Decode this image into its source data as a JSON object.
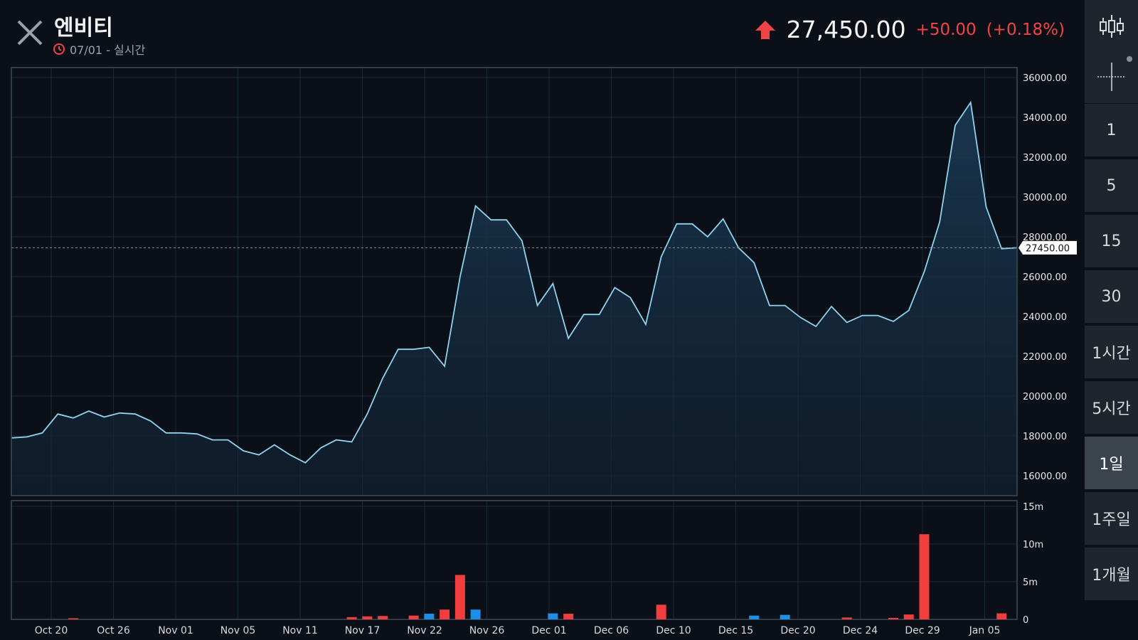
{
  "header": {
    "stock_name": "엔비티",
    "date_text": "07/01 - 실시간",
    "price": "27,450.00",
    "change": "+50.00",
    "change_pct": "(+0.18%)",
    "up_color": "#f24444"
  },
  "sidebar": {
    "items": [
      {
        "label": "",
        "icon": "candlestick-icon"
      },
      {
        "label": "",
        "icon": "crosshair-icon"
      },
      {
        "label": "1"
      },
      {
        "label": "5"
      },
      {
        "label": "15"
      },
      {
        "label": "30"
      },
      {
        "label": "1시간"
      },
      {
        "label": "5시간"
      },
      {
        "label": "1일",
        "active": true
      },
      {
        "label": "1주일"
      },
      {
        "label": "1개월"
      }
    ]
  },
  "chart_data": {
    "type": "area",
    "y_ticks": [
      "36000.00",
      "34000.00",
      "32000.00",
      "30000.00",
      "28000.00",
      "26000.00",
      "24000.00",
      "22000.00",
      "20000.00",
      "18000.00",
      "16000.00"
    ],
    "ylim": [
      15000,
      36500
    ],
    "x_ticks": [
      "Oct 20",
      "Oct 26",
      "Nov 01",
      "Nov 05",
      "Nov 11",
      "Nov 17",
      "Nov 22",
      "Nov 26",
      "Dec 01",
      "Dec 06",
      "Dec 10",
      "Dec 15",
      "Dec 20",
      "Dec 24",
      "Dec 29",
      "Jan 05"
    ],
    "last_price_label": "27450.00",
    "last_price": 27450,
    "line_color": "#8fd3ec",
    "series": [
      {
        "values": [
          17900,
          17950,
          18150,
          19100,
          18900,
          19250,
          18950,
          19150,
          19100,
          18750,
          18150,
          18150,
          18100,
          17800,
          17800,
          17250,
          17050,
          17550,
          17050,
          16650,
          17400,
          17800,
          17700,
          19100,
          20900,
          22350,
          22350,
          22450,
          21500,
          26000,
          29550,
          28850,
          28850,
          27800,
          24550,
          25650,
          22900,
          24100,
          24100,
          25450,
          24950,
          23600,
          27000,
          28650,
          28650,
          28000,
          28900,
          27450,
          26700,
          24550,
          24550,
          23950,
          23500,
          24500,
          23700,
          24050,
          24050,
          23750,
          24300,
          26250,
          28750,
          33600,
          34750,
          29500,
          27400,
          27450
        ]
      }
    ],
    "volume": {
      "y_ticks": [
        "15m",
        "10m",
        "5m",
        "0"
      ],
      "ylim": [
        0,
        15
      ],
      "up_color": "#f03e3e",
      "down_color": "#1f8ee6",
      "bars": [
        {
          "i": 4,
          "v": 0.15,
          "dir": "up"
        },
        {
          "i": 22,
          "v": 0.3,
          "dir": "up"
        },
        {
          "i": 23,
          "v": 0.4,
          "dir": "up"
        },
        {
          "i": 24,
          "v": 0.45,
          "dir": "up"
        },
        {
          "i": 26,
          "v": 0.5,
          "dir": "up"
        },
        {
          "i": 27,
          "v": 0.75,
          "dir": "down"
        },
        {
          "i": 28,
          "v": 1.3,
          "dir": "up"
        },
        {
          "i": 29,
          "v": 5.9,
          "dir": "up"
        },
        {
          "i": 30,
          "v": 1.3,
          "dir": "down"
        },
        {
          "i": 35,
          "v": 0.8,
          "dir": "down"
        },
        {
          "i": 36,
          "v": 0.75,
          "dir": "up"
        },
        {
          "i": 42,
          "v": 1.95,
          "dir": "up"
        },
        {
          "i": 48,
          "v": 0.5,
          "dir": "down"
        },
        {
          "i": 50,
          "v": 0.6,
          "dir": "down"
        },
        {
          "i": 54,
          "v": 0.25,
          "dir": "up"
        },
        {
          "i": 57,
          "v": 0.2,
          "dir": "up"
        },
        {
          "i": 58,
          "v": 0.65,
          "dir": "up"
        },
        {
          "i": 59,
          "v": 11.3,
          "dir": "up"
        },
        {
          "i": 64,
          "v": 0.8,
          "dir": "up"
        }
      ]
    }
  }
}
